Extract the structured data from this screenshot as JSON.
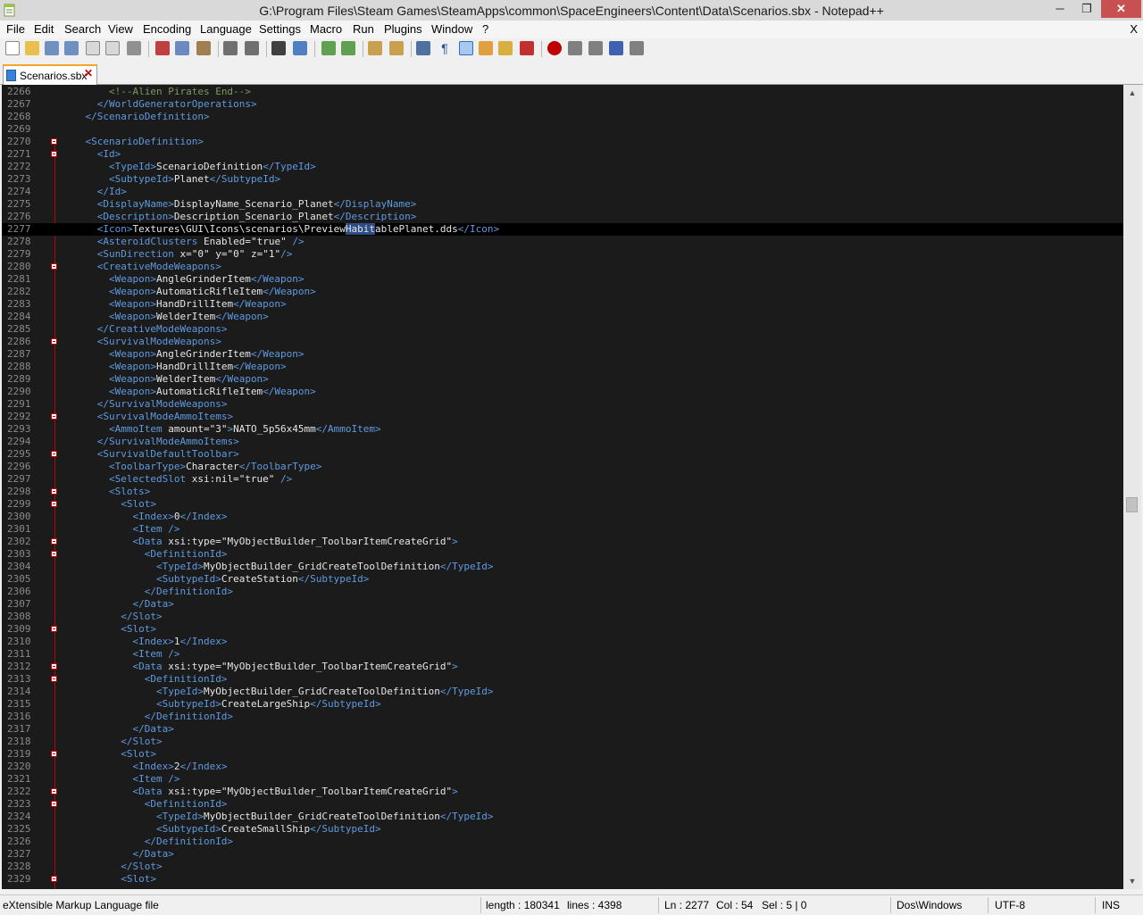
{
  "window": {
    "title": "G:\\Program Files\\Steam Games\\SteamApps\\common\\SpaceEngineers\\Content\\Data\\Scenarios.sbx - Notepad++",
    "minimize": "─",
    "maximize": "❐",
    "close": "✕"
  },
  "menu": {
    "items": [
      "File",
      "Edit",
      "Search",
      "View",
      "Encoding",
      "Language",
      "Settings",
      "Macro",
      "Run",
      "Plugins",
      "Window",
      "?"
    ],
    "close_doc": "X"
  },
  "tab": {
    "label": "Scenarios.sbx",
    "close": "✕"
  },
  "editor": {
    "lines": [
      {
        "n": "2266",
        "fold": false,
        "html": "        <span class=\"cm\">&lt;!--Alien Pirates End--&gt;</span>"
      },
      {
        "n": "2267",
        "fold": false,
        "html": "      <span class=\"tg\">&lt;/WorldGeneratorOperations&gt;</span>"
      },
      {
        "n": "2268",
        "fold": false,
        "html": "    <span class=\"tg\">&lt;/ScenarioDefinition&gt;</span>"
      },
      {
        "n": "2269",
        "fold": false,
        "html": ""
      },
      {
        "n": "2270",
        "fold": true,
        "html": "    <span class=\"tg\">&lt;ScenarioDefinition&gt;</span>"
      },
      {
        "n": "2271",
        "fold": true,
        "html": "      <span class=\"tg\">&lt;Id&gt;</span>"
      },
      {
        "n": "2272",
        "fold": false,
        "html": "        <span class=\"tg\">&lt;TypeId&gt;</span>ScenarioDefinition<span class=\"tg\">&lt;/TypeId&gt;</span>"
      },
      {
        "n": "2273",
        "fold": false,
        "html": "        <span class=\"tg\">&lt;SubtypeId&gt;</span>Planet<span class=\"tg\">&lt;/SubtypeId&gt;</span>"
      },
      {
        "n": "2274",
        "fold": false,
        "html": "      <span class=\"tg\">&lt;/Id&gt;</span>"
      },
      {
        "n": "2275",
        "fold": false,
        "html": "      <span class=\"tg\">&lt;DisplayName&gt;</span>DisplayName_Scenario_Planet<span class=\"tg\">&lt;/DisplayName&gt;</span>"
      },
      {
        "n": "2276",
        "fold": false,
        "html": "      <span class=\"tg\">&lt;Description&gt;</span>Description_Scenario_Planet<span class=\"tg\">&lt;/Description&gt;</span>"
      },
      {
        "n": "2277",
        "fold": false,
        "current": true,
        "html": "      <span class=\"tg\">&lt;Icon&gt;</span>Textures\\GUI\\Icons\\scenarios\\Preview<span class=\"sel\">Habit</span>ablePlanet.dds<span class=\"tg\">&lt;/Icon&gt;</span>"
      },
      {
        "n": "2278",
        "fold": false,
        "html": "      <span class=\"tg\">&lt;AsteroidClusters</span> <span class=\"at\">Enabled=</span><span class=\"av\">\"true\"</span> <span class=\"tg\">/&gt;</span>"
      },
      {
        "n": "2279",
        "fold": false,
        "html": "      <span class=\"tg\">&lt;SunDirection</span> <span class=\"at\">x=</span><span class=\"av\">\"0\"</span> <span class=\"at\">y=</span><span class=\"av\">\"0\"</span> <span class=\"at\">z=</span><span class=\"av\">\"1\"</span><span class=\"tg\">/&gt;</span>"
      },
      {
        "n": "2280",
        "fold": true,
        "html": "      <span class=\"tg\">&lt;CreativeModeWeapons&gt;</span>"
      },
      {
        "n": "2281",
        "fold": false,
        "html": "        <span class=\"tg\">&lt;Weapon&gt;</span>AngleGrinderItem<span class=\"tg\">&lt;/Weapon&gt;</span>"
      },
      {
        "n": "2282",
        "fold": false,
        "html": "        <span class=\"tg\">&lt;Weapon&gt;</span>AutomaticRifleItem<span class=\"tg\">&lt;/Weapon&gt;</span>"
      },
      {
        "n": "2283",
        "fold": false,
        "html": "        <span class=\"tg\">&lt;Weapon&gt;</span>HandDrillItem<span class=\"tg\">&lt;/Weapon&gt;</span>"
      },
      {
        "n": "2284",
        "fold": false,
        "html": "        <span class=\"tg\">&lt;Weapon&gt;</span>WelderItem<span class=\"tg\">&lt;/Weapon&gt;</span>"
      },
      {
        "n": "2285",
        "fold": false,
        "html": "      <span class=\"tg\">&lt;/CreativeModeWeapons&gt;</span>"
      },
      {
        "n": "2286",
        "fold": true,
        "html": "      <span class=\"tg\">&lt;SurvivalModeWeapons&gt;</span>"
      },
      {
        "n": "2287",
        "fold": false,
        "html": "        <span class=\"tg\">&lt;Weapon&gt;</span>AngleGrinderItem<span class=\"tg\">&lt;/Weapon&gt;</span>"
      },
      {
        "n": "2288",
        "fold": false,
        "html": "        <span class=\"tg\">&lt;Weapon&gt;</span>HandDrillItem<span class=\"tg\">&lt;/Weapon&gt;</span>"
      },
      {
        "n": "2289",
        "fold": false,
        "html": "        <span class=\"tg\">&lt;Weapon&gt;</span>WelderItem<span class=\"tg\">&lt;/Weapon&gt;</span>"
      },
      {
        "n": "2290",
        "fold": false,
        "html": "        <span class=\"tg\">&lt;Weapon&gt;</span>AutomaticRifleItem<span class=\"tg\">&lt;/Weapon&gt;</span>"
      },
      {
        "n": "2291",
        "fold": false,
        "html": "      <span class=\"tg\">&lt;/SurvivalModeWeapons&gt;</span>"
      },
      {
        "n": "2292",
        "fold": true,
        "html": "      <span class=\"tg\">&lt;SurvivalModeAmmoItems&gt;</span>"
      },
      {
        "n": "2293",
        "fold": false,
        "html": "        <span class=\"tg\">&lt;AmmoItem</span> <span class=\"at\">amount=</span><span class=\"av\">\"3\"</span><span class=\"tg\">&gt;</span>NATO_5p56x45mm<span class=\"tg\">&lt;/AmmoItem&gt;</span>"
      },
      {
        "n": "2294",
        "fold": false,
        "html": "      <span class=\"tg\">&lt;/SurvivalModeAmmoItems&gt;</span>"
      },
      {
        "n": "2295",
        "fold": true,
        "html": "      <span class=\"tg\">&lt;SurvivalDefaultToolbar&gt;</span>"
      },
      {
        "n": "2296",
        "fold": false,
        "html": "        <span class=\"tg\">&lt;ToolbarType&gt;</span>Character<span class=\"tg\">&lt;/ToolbarType&gt;</span>"
      },
      {
        "n": "2297",
        "fold": false,
        "html": "        <span class=\"tg\">&lt;SelectedSlot</span> <span class=\"at\">xsi:nil=</span><span class=\"av\">\"true\"</span> <span class=\"tg\">/&gt;</span>"
      },
      {
        "n": "2298",
        "fold": true,
        "html": "        <span class=\"tg\">&lt;Slots&gt;</span>"
      },
      {
        "n": "2299",
        "fold": true,
        "html": "          <span class=\"tg\">&lt;Slot&gt;</span>"
      },
      {
        "n": "2300",
        "fold": false,
        "html": "            <span class=\"tg\">&lt;Index&gt;</span>0<span class=\"tg\">&lt;/Index&gt;</span>"
      },
      {
        "n": "2301",
        "fold": false,
        "html": "            <span class=\"tg\">&lt;Item /&gt;</span>"
      },
      {
        "n": "2302",
        "fold": true,
        "html": "            <span class=\"tg\">&lt;Data</span> <span class=\"at\">xsi:type=</span><span class=\"av\">\"MyObjectBuilder_ToolbarItemCreateGrid\"</span><span class=\"tg\">&gt;</span>"
      },
      {
        "n": "2303",
        "fold": true,
        "html": "              <span class=\"tg\">&lt;DefinitionId&gt;</span>"
      },
      {
        "n": "2304",
        "fold": false,
        "html": "                <span class=\"tg\">&lt;TypeId&gt;</span>MyObjectBuilder_GridCreateToolDefinition<span class=\"tg\">&lt;/TypeId&gt;</span>"
      },
      {
        "n": "2305",
        "fold": false,
        "html": "                <span class=\"tg\">&lt;SubtypeId&gt;</span>CreateStation<span class=\"tg\">&lt;/SubtypeId&gt;</span>"
      },
      {
        "n": "2306",
        "fold": false,
        "html": "              <span class=\"tg\">&lt;/DefinitionId&gt;</span>"
      },
      {
        "n": "2307",
        "fold": false,
        "html": "            <span class=\"tg\">&lt;/Data&gt;</span>"
      },
      {
        "n": "2308",
        "fold": false,
        "html": "          <span class=\"tg\">&lt;/Slot&gt;</span>"
      },
      {
        "n": "2309",
        "fold": true,
        "html": "          <span class=\"tg\">&lt;Slot&gt;</span>"
      },
      {
        "n": "2310",
        "fold": false,
        "html": "            <span class=\"tg\">&lt;Index&gt;</span>1<span class=\"tg\">&lt;/Index&gt;</span>"
      },
      {
        "n": "2311",
        "fold": false,
        "html": "            <span class=\"tg\">&lt;Item /&gt;</span>"
      },
      {
        "n": "2312",
        "fold": true,
        "html": "            <span class=\"tg\">&lt;Data</span> <span class=\"at\">xsi:type=</span><span class=\"av\">\"MyObjectBuilder_ToolbarItemCreateGrid\"</span><span class=\"tg\">&gt;</span>"
      },
      {
        "n": "2313",
        "fold": true,
        "html": "              <span class=\"tg\">&lt;DefinitionId&gt;</span>"
      },
      {
        "n": "2314",
        "fold": false,
        "html": "                <span class=\"tg\">&lt;TypeId&gt;</span>MyObjectBuilder_GridCreateToolDefinition<span class=\"tg\">&lt;/TypeId&gt;</span>"
      },
      {
        "n": "2315",
        "fold": false,
        "html": "                <span class=\"tg\">&lt;SubtypeId&gt;</span>CreateLargeShip<span class=\"tg\">&lt;/SubtypeId&gt;</span>"
      },
      {
        "n": "2316",
        "fold": false,
        "html": "              <span class=\"tg\">&lt;/DefinitionId&gt;</span>"
      },
      {
        "n": "2317",
        "fold": false,
        "html": "            <span class=\"tg\">&lt;/Data&gt;</span>"
      },
      {
        "n": "2318",
        "fold": false,
        "html": "          <span class=\"tg\">&lt;/Slot&gt;</span>"
      },
      {
        "n": "2319",
        "fold": true,
        "html": "          <span class=\"tg\">&lt;Slot&gt;</span>"
      },
      {
        "n": "2320",
        "fold": false,
        "html": "            <span class=\"tg\">&lt;Index&gt;</span>2<span class=\"tg\">&lt;/Index&gt;</span>"
      },
      {
        "n": "2321",
        "fold": false,
        "html": "            <span class=\"tg\">&lt;Item /&gt;</span>"
      },
      {
        "n": "2322",
        "fold": true,
        "html": "            <span class=\"tg\">&lt;Data</span> <span class=\"at\">xsi:type=</span><span class=\"av\">\"MyObjectBuilder_ToolbarItemCreateGrid\"</span><span class=\"tg\">&gt;</span>"
      },
      {
        "n": "2323",
        "fold": true,
        "html": "              <span class=\"tg\">&lt;DefinitionId&gt;</span>"
      },
      {
        "n": "2324",
        "fold": false,
        "html": "                <span class=\"tg\">&lt;TypeId&gt;</span>MyObjectBuilder_GridCreateToolDefinition<span class=\"tg\">&lt;/TypeId&gt;</span>"
      },
      {
        "n": "2325",
        "fold": false,
        "html": "                <span class=\"tg\">&lt;SubtypeId&gt;</span>CreateSmallShip<span class=\"tg\">&lt;/SubtypeId&gt;</span>"
      },
      {
        "n": "2326",
        "fold": false,
        "html": "              <span class=\"tg\">&lt;/DefinitionId&gt;</span>"
      },
      {
        "n": "2327",
        "fold": false,
        "html": "            <span class=\"tg\">&lt;/Data&gt;</span>"
      },
      {
        "n": "2328",
        "fold": false,
        "html": "          <span class=\"tg\">&lt;/Slot&gt;</span>"
      },
      {
        "n": "2329",
        "fold": true,
        "html": "          <span class=\"tg\">&lt;Slot&gt;</span>"
      }
    ]
  },
  "status": {
    "file_type": "eXtensible Markup Language file",
    "length": "length : 180341",
    "lines": "lines : 4398",
    "ln": "Ln : 2277",
    "col": "Col : 54",
    "sel": "Sel : 5 | 0",
    "eol": "Dos\\Windows",
    "encoding": "UTF-8",
    "mode": "INS"
  }
}
